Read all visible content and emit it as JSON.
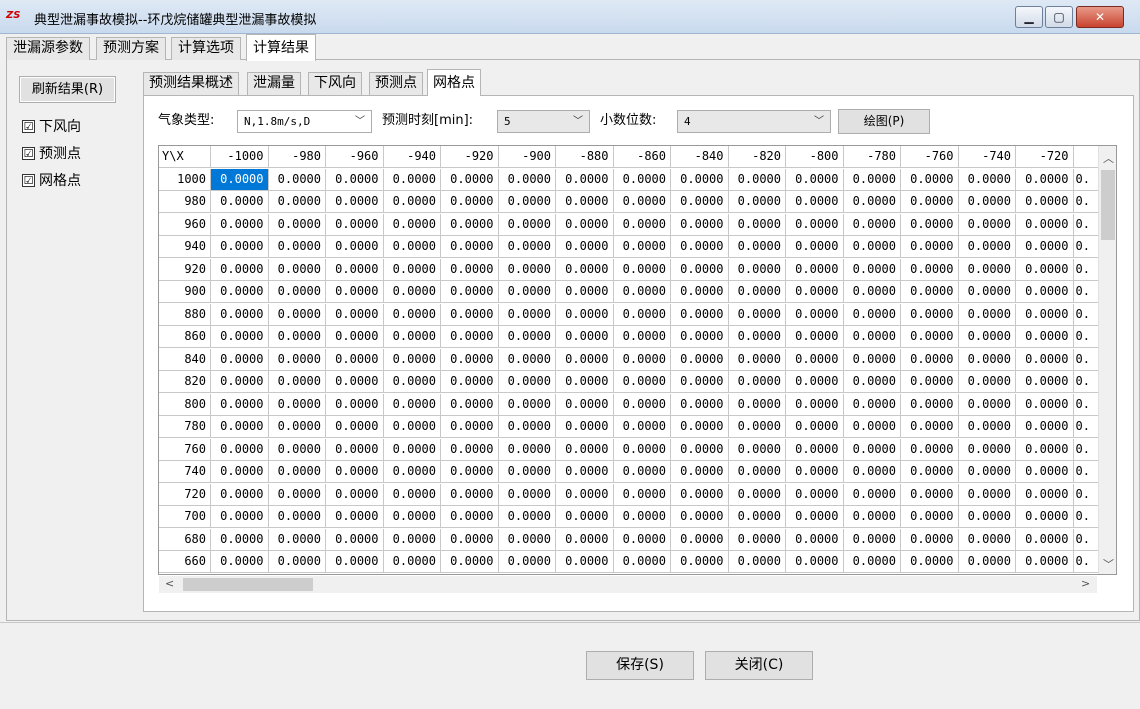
{
  "window": {
    "icon_text": "ZS",
    "title": "典型泄漏事故模拟--环戊烷储罐典型泄漏事故模拟",
    "min_label": "▁",
    "max_label": "▢",
    "close_label": "✕"
  },
  "top_tabs": [
    "泄漏源参数",
    "预测方案",
    "计算选项",
    "计算结果"
  ],
  "left": {
    "refresh_label": "刷新结果(R)",
    "checks": [
      {
        "label": "下风向",
        "checked": "☑"
      },
      {
        "label": "预测点",
        "checked": "☑"
      },
      {
        "label": "网格点",
        "checked": "☑"
      }
    ]
  },
  "inner_tabs": [
    "预测结果概述",
    "泄漏量",
    "下风向",
    "预测点",
    "网格点"
  ],
  "controls": {
    "weather_label": "气象类型:",
    "weather_value": "N,1.8m/s,D",
    "time_label": "预测时刻[min]:",
    "time_value": "5",
    "decimals_label": "小数位数:",
    "decimals_value": "4",
    "plot_label": "绘图(P)"
  },
  "grid": {
    "corner": "Y\\X",
    "x_headers": [
      "-1000",
      "-980",
      "-960",
      "-940",
      "-920",
      "-900",
      "-880",
      "-860",
      "-840",
      "-820",
      "-800",
      "-780",
      "-760",
      "-740",
      "-720"
    ],
    "y_headers": [
      "1000",
      "980",
      "960",
      "940",
      "920",
      "900",
      "880",
      "860",
      "840",
      "820",
      "800",
      "780",
      "760",
      "740",
      "720",
      "700",
      "680",
      "660"
    ],
    "cell_value": "0.0000",
    "partial_cell": "0."
  },
  "bottom": {
    "save_label": "保存(S)",
    "close_label": "关闭(C)"
  }
}
